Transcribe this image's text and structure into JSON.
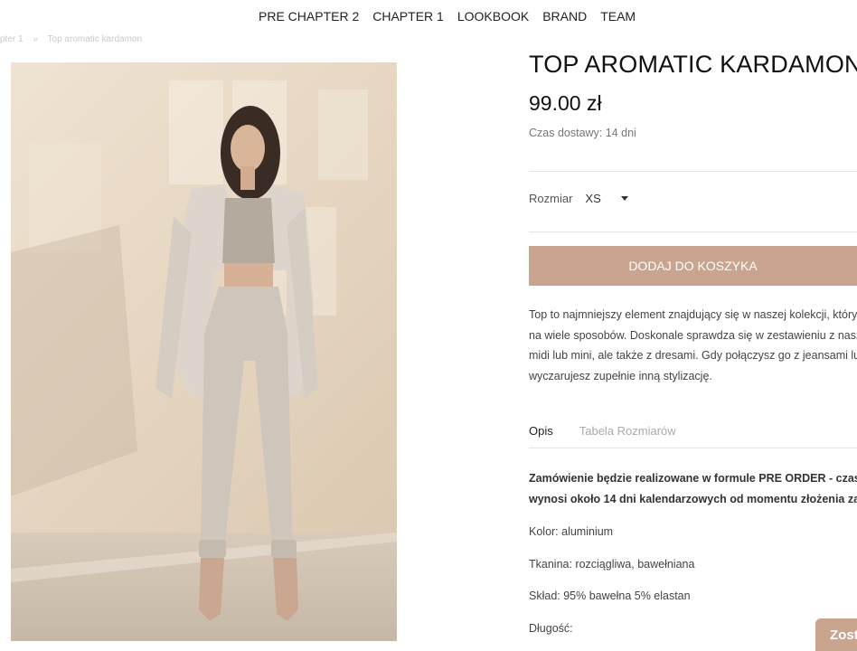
{
  "nav": {
    "items": [
      "PRE CHAPTER 2",
      "CHAPTER 1",
      "LOOKBOOK",
      "BRAND",
      "TEAM"
    ]
  },
  "breadcrumb": {
    "items": [
      "pter 1",
      "»",
      "Top aromatic kardamon"
    ]
  },
  "product": {
    "title": "TOP AROMATIC KARDAMON",
    "price": "99.00 zł",
    "delivery": "Czas dostawy: 14 dni",
    "size_label": "Rozmiar",
    "size_value": "XS",
    "add_to_cart": "DODAJ DO KOSZYKA",
    "description": [
      "Top to najmniejszy element znajdujący się w naszej kolekcji, który",
      "na wiele sposobów. Doskonale sprawdza się w zestawieniu z nasz",
      "midi lub mini, ale także z dresami. Gdy połączysz go z jeansami lub",
      "wyczarujesz zupełnie inną stylizację."
    ]
  },
  "tabs": {
    "active": "Opis",
    "inactive": "Tabela Rozmiarów"
  },
  "details": {
    "order_line1": "Zamówienie  będzie realizowane w formule PRE ORDER - czas r",
    "order_line2": "wynosi około 14 dni kalendarzowych od momentu złożenia zam",
    "color": "Kolor: aluminium",
    "fabric": "Tkanina: rozciągliwa, bawełniana",
    "composition": "Skład: 95% bawełna 5% elastan",
    "length": "Długość:"
  },
  "chat": {
    "label": "Zost"
  },
  "colors": {
    "accent": "#c9a48e",
    "photo_bg": "#e6d6c1",
    "outfit": "#cfc6bb"
  }
}
